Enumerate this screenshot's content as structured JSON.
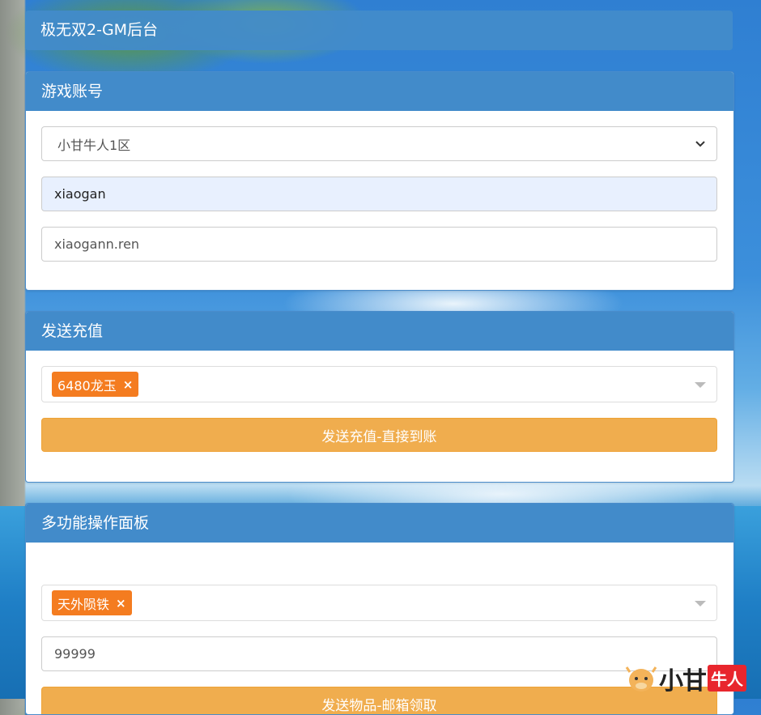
{
  "header": {
    "title": "极无双2-GM后台"
  },
  "account": {
    "title": "游戏账号",
    "server_selected": "小甘牛人1区",
    "username_value": "xiaogan",
    "password_value": "xiaogann.ren"
  },
  "recharge": {
    "title": "发送充值",
    "tag_label": "6480龙玉",
    "remove_symbol": "×",
    "button_label": "发送充值-直接到账"
  },
  "multi": {
    "title": "多功能操作面板",
    "tag_label": "天外陨铁",
    "remove_symbol": "×",
    "quantity_value": "99999",
    "button_label": "发送物品-邮箱领取"
  },
  "watermark": {
    "text_main": "小甘",
    "text_badge": "牛人"
  },
  "colors": {
    "primary": "#428bca",
    "warning": "#f0ad4e",
    "tag": "#f47c20"
  }
}
